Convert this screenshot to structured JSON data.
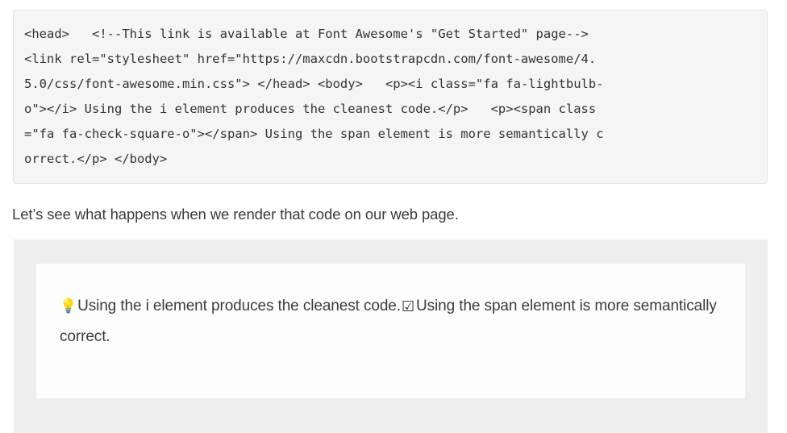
{
  "code_block": {
    "language": "html",
    "background": "#f5f5f5",
    "border_color": "#e3e3e3",
    "lines": [
      "<head>   <!--This link is available at Font Awesome's \"Get Started\" page-->",
      "<link rel=\"stylesheet\" href=\"https://maxcdn.bootstrapcdn.com/font-awesome/4.",
      "5.0/css/font-awesome.min.css\"> </head> <body>   <p><i class=\"fa fa-lightbulb-",
      "o\"></i> Using the i element produces the cleanest code.</p>   <p><span class",
      "=\"fa fa-check-square-o\"></span> Using the span element is more semantically c",
      "orrect.</p> </body>"
    ],
    "full_text": "<head>   <!--This link is available at Font Awesome's \"Get Started\" page--> <link rel=\"stylesheet\" href=\"https://maxcdn.bootstrapcdn.com/font-awesome/4.5.0/css/font-awesome.min.css\"> </head> <body>   <p><i class=\"fa fa-lightbulb-o\"></i> Using the i element produces the cleanest code.</p>   <p><span class=\"fa fa-check-square-o\"></span> Using the span element is more semantically correct.</p> </body>"
  },
  "paragraph": {
    "text": "Let’s see what happens when we render that code on our web page."
  },
  "render_preview": {
    "outer_background": "#eeeeee",
    "page_background": "#fdfdfd",
    "icons": {
      "lightbulb": "lightbulb-outline-icon",
      "check_square": "check-square-outline-icon"
    },
    "glyphs": {
      "lightbulb": "Ὂ1",
      "check_square": "☑"
    },
    "line_one_text": "Using the i element produces the cleanest code.",
    "line_two_text": "Using the span element is more semantically correct."
  }
}
